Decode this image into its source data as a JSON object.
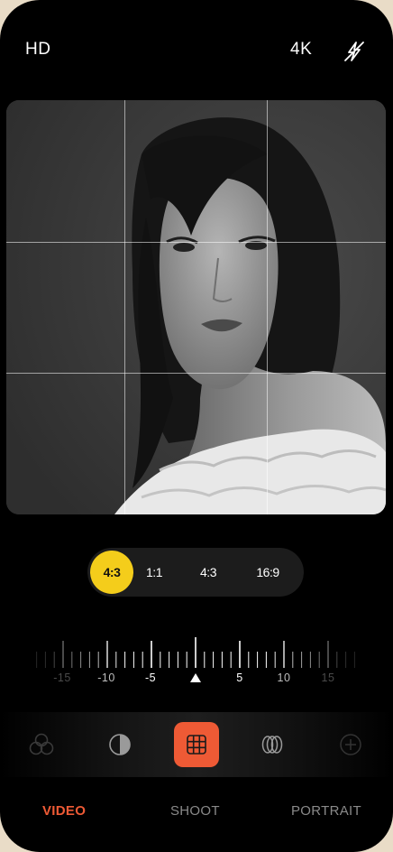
{
  "topbar": {
    "quality_left": "HD",
    "quality_right": "4K",
    "flash_icon": "flash-off-icon"
  },
  "aspect_ratios": {
    "selected": "4:3",
    "options": [
      "1:1",
      "4:3",
      "16:9"
    ]
  },
  "exposure": {
    "labels": [
      "-15",
      "-10",
      "-5",
      "5",
      "10",
      "15"
    ],
    "indicator_icon": "triangle-up-icon",
    "value": 0
  },
  "tools": [
    {
      "icon": "filters-icon",
      "active": false
    },
    {
      "icon": "contrast-icon",
      "active": false
    },
    {
      "icon": "grid-icon",
      "active": true
    },
    {
      "icon": "rings-icon",
      "active": false
    },
    {
      "icon": "add-icon",
      "active": false
    }
  ],
  "modes": [
    {
      "label": "VIDEO",
      "active": true
    },
    {
      "label": "SHOOT",
      "active": false
    },
    {
      "label": "PORTRAIT",
      "active": false
    }
  ],
  "colors": {
    "accent_yellow": "#f4cd1b",
    "accent_orange": "#ee5a35",
    "background": "#000000"
  }
}
